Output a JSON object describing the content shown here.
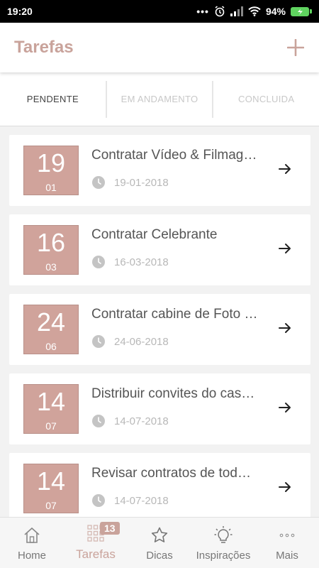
{
  "status_bar": {
    "time": "19:20",
    "battery": "94%"
  },
  "header": {
    "title": "Tarefas"
  },
  "tabs": [
    {
      "label": "PENDENTE",
      "active": true
    },
    {
      "label": "EM ANDAMENTO",
      "active": false
    },
    {
      "label": "CONCLUIDA",
      "active": false
    }
  ],
  "tasks": [
    {
      "day": "19",
      "month": "01",
      "title": "Contratar Vídeo & Filmag…",
      "date": "19-01-2018"
    },
    {
      "day": "16",
      "month": "03",
      "title": "Contratar Celebrante",
      "date": "16-03-2018"
    },
    {
      "day": "24",
      "month": "06",
      "title": "Contratar cabine de Foto …",
      "date": "24-06-2018"
    },
    {
      "day": "14",
      "month": "07",
      "title": "Distribuir convites do cas…",
      "date": "14-07-2018"
    },
    {
      "day": "14",
      "month": "07",
      "title": "Revisar contratos de tod…",
      "date": "14-07-2018"
    }
  ],
  "nav": [
    {
      "label": "Home",
      "icon": "home-icon",
      "active": false
    },
    {
      "label": "Tarefas",
      "icon": "grid-icon",
      "active": true,
      "badge": "13"
    },
    {
      "label": "Dicas",
      "icon": "star-icon",
      "active": false
    },
    {
      "label": "Inspirações",
      "icon": "lightbulb-icon",
      "active": false
    },
    {
      "label": "Mais",
      "icon": "more-icon",
      "active": false
    }
  ],
  "colors": {
    "accent": "#c9a39b",
    "date_box": "#d0a39b"
  }
}
